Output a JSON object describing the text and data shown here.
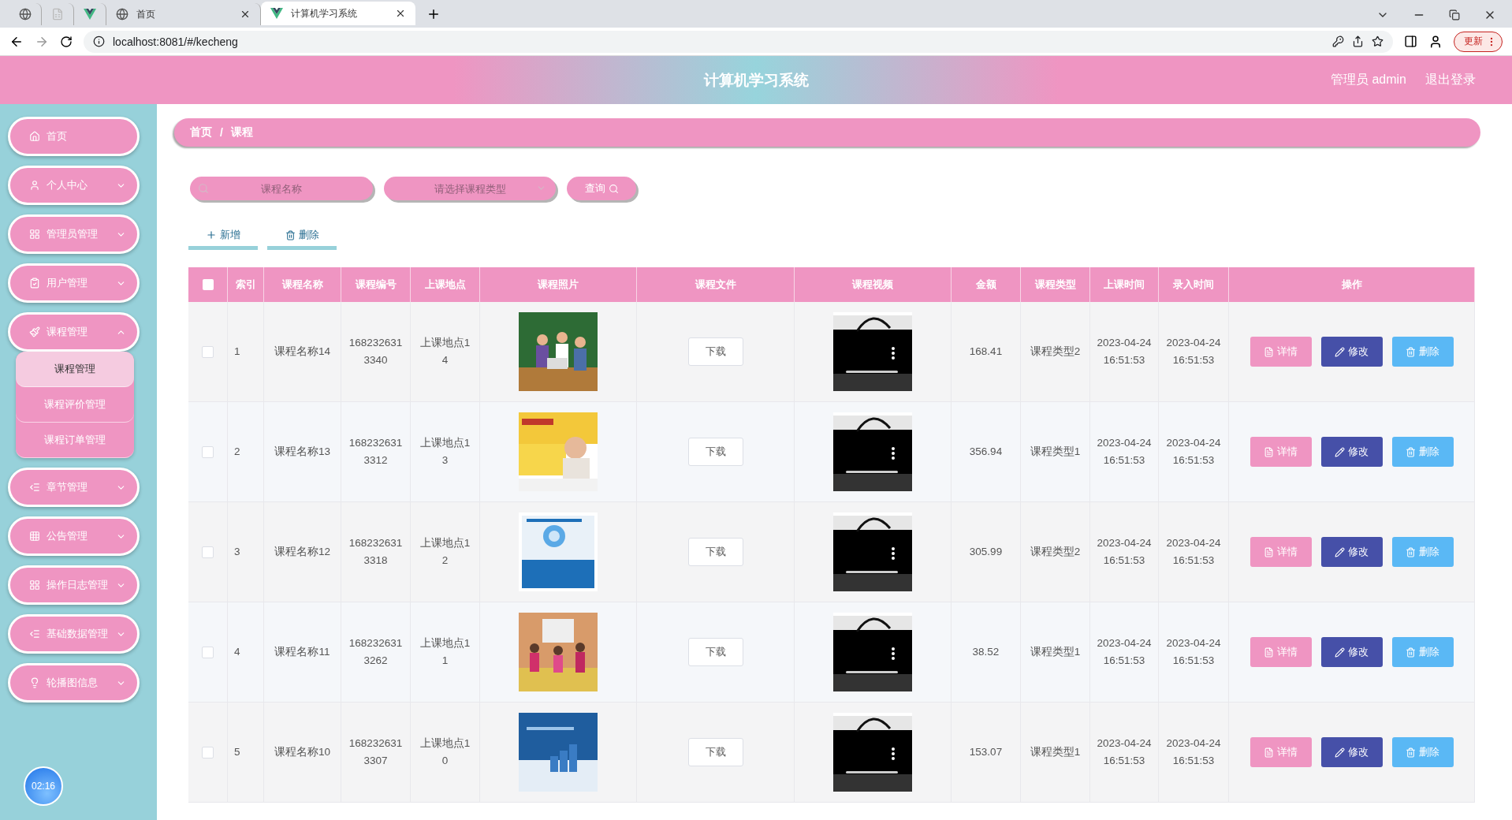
{
  "browser": {
    "tabs": [
      {
        "kind": "globe",
        "selected": false
      },
      {
        "kind": "page",
        "selected": false
      },
      {
        "kind": "vue",
        "selected": false
      },
      {
        "kind": "globe",
        "title": "首页",
        "selected": false
      },
      {
        "kind": "vue",
        "title": "计算机学习系统",
        "selected": true
      }
    ],
    "address": "localhost:8081/#/kecheng",
    "update_button": "更新"
  },
  "header": {
    "title": "计算机学习系统",
    "user": "管理员 admin",
    "logout": "退出登录"
  },
  "sidebar": {
    "items": [
      {
        "kind": "link",
        "label": "首页"
      },
      {
        "kind": "menu",
        "label": "个人中心",
        "expanded": false
      },
      {
        "kind": "menu",
        "label": "管理员管理",
        "expanded": false
      },
      {
        "kind": "menu",
        "label": "用户管理",
        "expanded": false
      },
      {
        "kind": "menu",
        "label": "课程管理",
        "expanded": true,
        "children": [
          {
            "label": "课程管理",
            "selected": true
          },
          {
            "label": "课程评价管理",
            "selected": false
          },
          {
            "label": "课程订单管理",
            "selected": false
          }
        ]
      },
      {
        "kind": "menu",
        "label": "章节管理",
        "expanded": false
      },
      {
        "kind": "menu",
        "label": "公告管理",
        "expanded": false
      },
      {
        "kind": "menu",
        "label": "操作日志管理",
        "expanded": false
      },
      {
        "kind": "menu",
        "label": "基础数据管理",
        "expanded": false
      },
      {
        "kind": "menu",
        "label": "轮播图信息",
        "expanded": false
      }
    ],
    "clock": "02:16"
  },
  "breadcrumb": {
    "items": [
      "首页",
      "课程"
    ],
    "separator": "/"
  },
  "search": {
    "name_placeholder": "课程名称",
    "type_placeholder": "请选择课程类型",
    "query_button": "查询"
  },
  "actions": {
    "add": "新增",
    "delete": "删除"
  },
  "table": {
    "select_all": {
      "checked": false
    },
    "columns": [
      "索引",
      "课程名称",
      "课程编号",
      "上课地点",
      "课程照片",
      "课程文件",
      "课程视频",
      "金额",
      "课程类型",
      "上课时间",
      "录入时间",
      "操作"
    ],
    "rows": [
      {
        "checked": false,
        "index": "1",
        "name": "课程名称14",
        "code": "1682326313340",
        "place": "上课地点14",
        "file": "下载",
        "price": "168.41",
        "type": "课程类型2",
        "class_time": "2023-04-24 16:51:53",
        "entry_time": "2023-04-24 16:51:53",
        "buttons": [
          "详情",
          "修改",
          "删除"
        ]
      },
      {
        "checked": false,
        "index": "2",
        "name": "课程名称13",
        "code": "1682326313312",
        "place": "上课地点13",
        "file": "下载",
        "price": "356.94",
        "type": "课程类型1",
        "class_time": "2023-04-24 16:51:53",
        "entry_time": "2023-04-24 16:51:53",
        "buttons": [
          "详情",
          "修改",
          "删除"
        ]
      },
      {
        "checked": false,
        "index": "3",
        "name": "课程名称12",
        "code": "1682326313318",
        "place": "上课地点12",
        "file": "下载",
        "price": "305.99",
        "type": "课程类型2",
        "class_time": "2023-04-24 16:51:53",
        "entry_time": "2023-04-24 16:51:53",
        "buttons": [
          "详情",
          "修改",
          "删除"
        ]
      },
      {
        "checked": false,
        "index": "4",
        "name": "课程名称11",
        "code": "1682326313262",
        "place": "上课地点11",
        "file": "下载",
        "price": "38.52",
        "type": "课程类型1",
        "class_time": "2023-04-24 16:51:53",
        "entry_time": "2023-04-24 16:51:53",
        "buttons": [
          "详情",
          "修改",
          "删除"
        ]
      },
      {
        "checked": false,
        "index": "5",
        "name": "课程名称10",
        "code": "1682326313307",
        "place": "上课地点10",
        "file": "下载",
        "price": "153.07",
        "type": "课程类型1",
        "class_time": "2023-04-24 16:51:53",
        "entry_time": "2023-04-24 16:51:53",
        "buttons": [
          "详情",
          "修改",
          "删除"
        ]
      }
    ]
  }
}
